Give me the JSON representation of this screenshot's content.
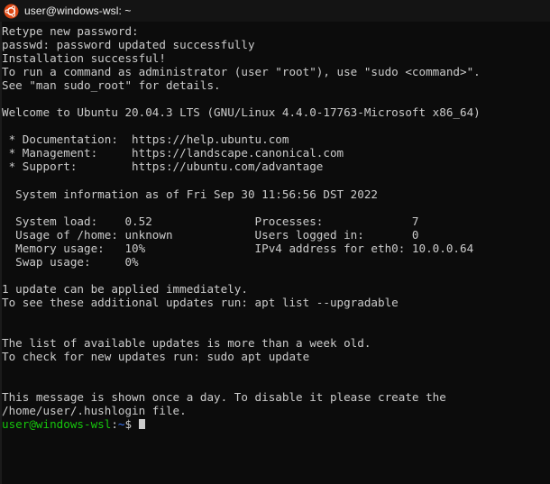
{
  "window": {
    "titlebar": {
      "icon": "ubuntu-logo-icon",
      "title": "user@windows-wsl: ~",
      "background_color": "#141414",
      "text_color": "#f2f2f2"
    },
    "background_color": "#0c0c0c",
    "foreground_color": "#cccccc"
  },
  "terminal": {
    "lines": [
      "Retype new password:",
      "passwd: password updated successfully",
      "Installation successful!",
      "To run a command as administrator (user \"root\"), use \"sudo <command>\".",
      "See \"man sudo_root\" for details.",
      "",
      "Welcome to Ubuntu 20.04.3 LTS (GNU/Linux 4.4.0-17763-Microsoft x86_64)",
      "",
      " * Documentation:  https://help.ubuntu.com",
      " * Management:     https://landscape.canonical.com",
      " * Support:        https://ubuntu.com/advantage",
      "",
      "  System information as of Fri Sep 30 11:56:56 DST 2022",
      "",
      "  System load:    0.52               Processes:             7",
      "  Usage of /home: unknown            Users logged in:       0",
      "  Memory usage:   10%                IPv4 address for eth0: 10.0.0.64",
      "  Swap usage:     0%",
      "",
      "1 update can be applied immediately.",
      "To see these additional updates run: apt list --upgradable",
      "",
      "",
      "The list of available updates is more than a week old.",
      "To check for new updates run: sudo apt update",
      "",
      "",
      "This message is shown once a day. To disable it please create the",
      "/home/user/.hushlogin file."
    ],
    "prompt": {
      "user_host": "user@windows-wsl",
      "colon": ":",
      "path": "~",
      "dollar": "$",
      "space": " ",
      "user_host_color": "#16c60c",
      "path_color": "#3b78ff",
      "punct_color": "#cccccc",
      "cursor_color": "#cccccc"
    },
    "system_info": {
      "header": "System information as of Fri Sep 30 11:56:56 DST 2022",
      "metrics": [
        {
          "label": "System load:",
          "value": "0.52",
          "label2": "Processes:",
          "value2": "7"
        },
        {
          "label": "Usage of /home:",
          "value": "unknown",
          "label2": "Users logged in:",
          "value2": "0"
        },
        {
          "label": "Memory usage:",
          "value": "10%",
          "label2": "IPv4 address for eth0:",
          "value2": "10.0.0.64"
        },
        {
          "label": "Swap usage:",
          "value": "0%",
          "label2": "",
          "value2": ""
        }
      ]
    },
    "links": [
      {
        "label": "* Documentation:",
        "url": "https://help.ubuntu.com"
      },
      {
        "label": "* Management:",
        "url": "https://landscape.canonical.com"
      },
      {
        "label": "* Support:",
        "url": "https://ubuntu.com/advantage"
      }
    ]
  }
}
